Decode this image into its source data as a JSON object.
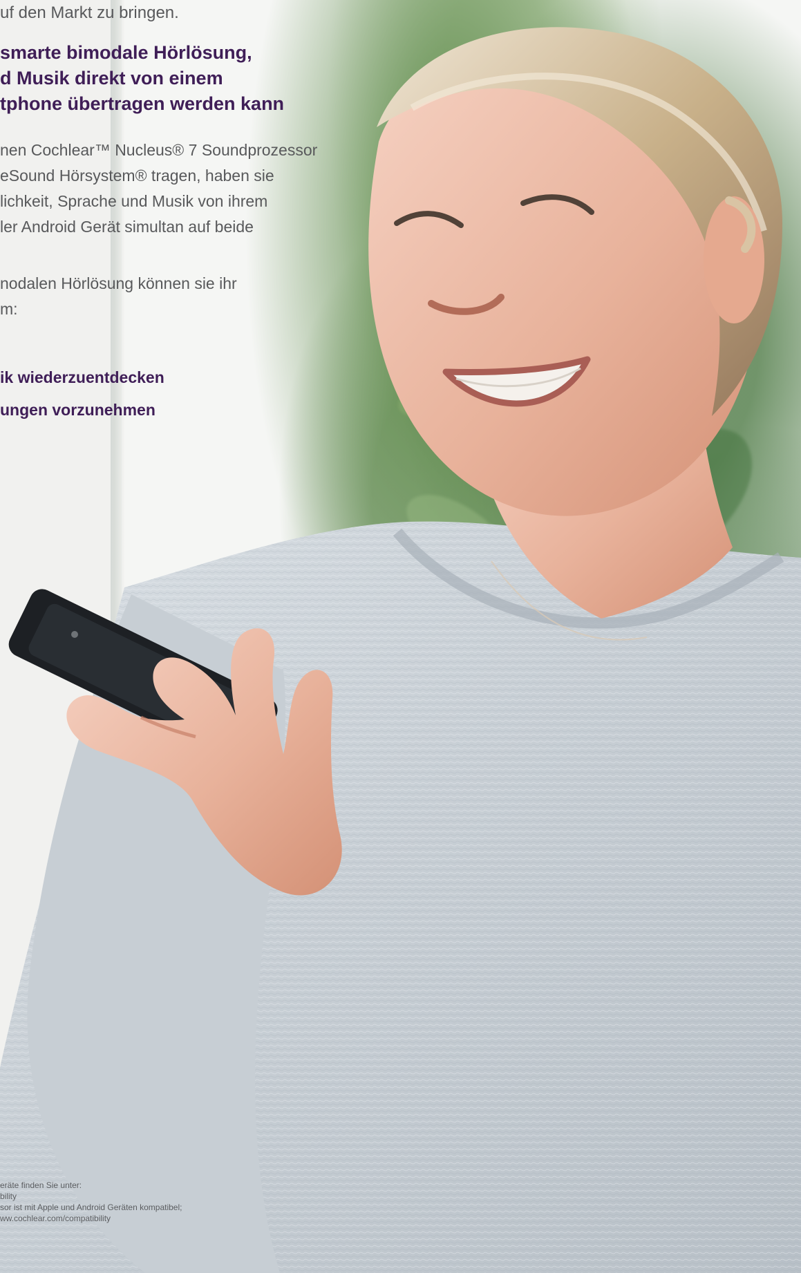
{
  "document": {
    "intro_line": "uf den Markt zu bringen.",
    "headline": "smarte bimodale Hörlösung,\nd Musik direkt von einem\ntphone übertragen werden kann",
    "paragraph_1": "nen Cochlear™ Nucleus® 7 Soundprozessor\neSound Hörsystem® tragen, haben sie\nlichkeit, Sprache und Musik von ihrem\nler Android Gerät simultan auf beide",
    "paragraph_2": "nodalen Hörlösung können sie ihr\nm:",
    "bullets": [
      "ik wiederzuentdecken",
      "ungen vorzunehmen"
    ],
    "footnotes": "eräte finden Sie unter:\nbility\nsor ist mit Apple und Android Geräten kompatibel;\nww.cochlear.com/compatibility"
  },
  "photo": {
    "subject": "Frau mit Smartphone",
    "accent_color": "#3f1e57",
    "background_color": "#e9ecea"
  }
}
